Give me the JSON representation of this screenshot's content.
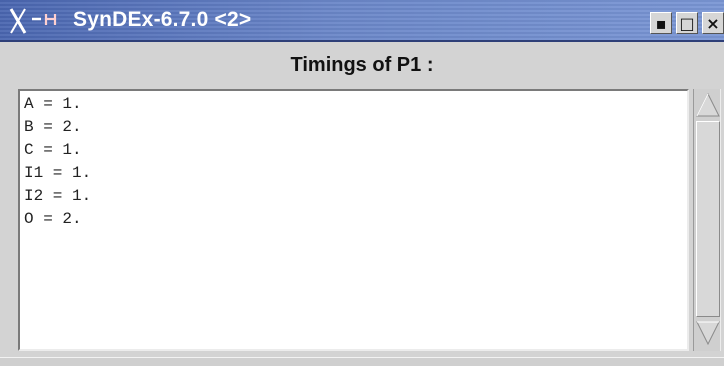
{
  "window": {
    "title": "SynDEx-6.7.0 <2>",
    "title_icon": "x-logo-icon",
    "title_buttons": [
      "minimize",
      "maximize",
      "close"
    ],
    "title_buttons_glyphs": {
      "minimize": "▪",
      "maximize": "□",
      "close": "×"
    }
  },
  "heading": "Timings of P1 :",
  "timings": [
    "A = 1.",
    "B = 2.",
    "C = 1.",
    "I1 = 1.",
    "I2 = 1.",
    "O = 2."
  ],
  "colors": {
    "titlebar": "#5b78bf",
    "title_text": "#ffffff",
    "window_bg": "#d3d3d3",
    "text_area_bg": "#ffffff"
  }
}
